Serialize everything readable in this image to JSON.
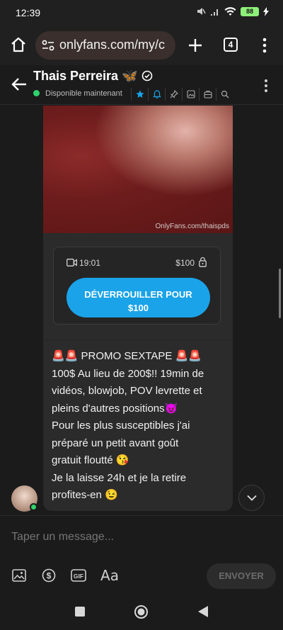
{
  "status_bar": {
    "time": "12:39",
    "battery": "88"
  },
  "browser": {
    "url": "onlyfans.com/my/c",
    "tab_count": "4"
  },
  "chat": {
    "contact_name": "Thais Perreira",
    "name_emoji": "🦋",
    "availability": "Disponible maintenant"
  },
  "media": {
    "watermark": "OnlyFans.com/thaispds"
  },
  "locked_post": {
    "duration": "19:01",
    "price": "$100",
    "unlock_line1": "DÉVERROUILLER POUR",
    "unlock_line2": "$100"
  },
  "message_lines": [
    "🚨🚨 PROMO SEXTAPE 🚨🚨",
    "100$ Au lieu de 200$!! 19min de",
    "vidéos, blowjob, POV levrette et",
    "pleins d'autres positions😈",
    "Pour les plus susceptibles j'ai",
    "préparé un petit avant goût",
    "gratuit floutté 😘",
    "Je la laisse 24h et je la retire",
    "profites-en 😉"
  ],
  "composer": {
    "placeholder": "Taper un message...",
    "send_label": "ENVOYER",
    "text_format_label": "Aa",
    "gif_label": "GIF"
  },
  "colors": {
    "accent": "#1aa3e8",
    "online": "#2fd36b",
    "battery": "#8ef07a"
  }
}
